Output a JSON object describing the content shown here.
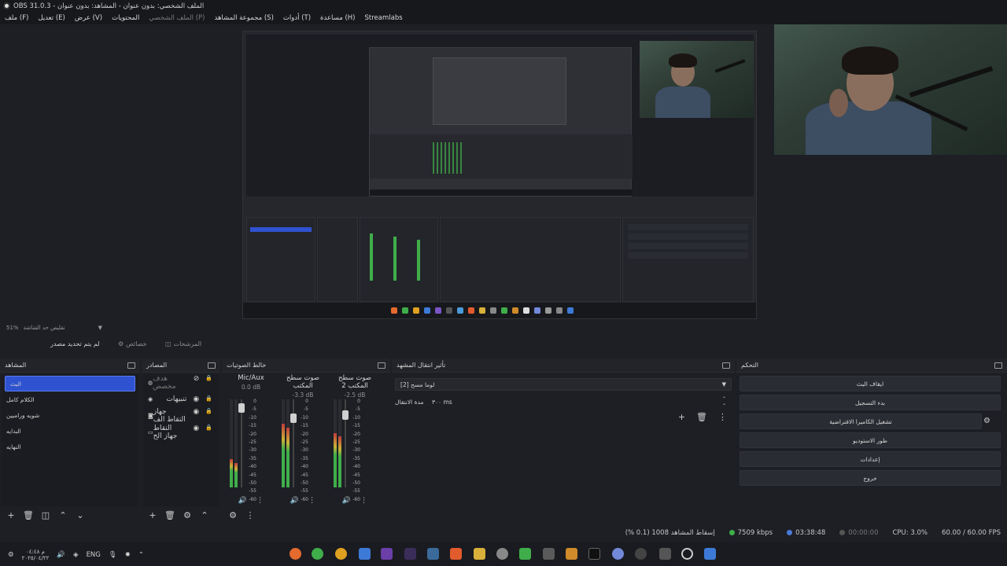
{
  "window": {
    "title": "OBS 31.0.3 - الملف الشخصي: بدون عنوان - المشاهد: بدون عنوان"
  },
  "menu": {
    "items": [
      {
        "label": "ملف (F)",
        "dim": false
      },
      {
        "label": "تعديل (E)",
        "dim": false
      },
      {
        "label": "عرض (V)",
        "dim": false
      },
      {
        "label": "المحتويات",
        "dim": false
      },
      {
        "label": "الملف الشخصي (P)",
        "dim": true
      },
      {
        "label": "مجموعة المشاهد (S)",
        "dim": false
      },
      {
        "label": "أدوات (T)",
        "dim": false
      },
      {
        "label": "مساعدة (H)",
        "dim": false
      },
      {
        "label": "Streamlabs",
        "dim": false
      }
    ]
  },
  "preview": {
    "zoom_label": "51%",
    "zoom_hint": "تقليص حد الشاشة"
  },
  "toolbar": {
    "no_source": "لم يتم تحديد مصدر",
    "properties": "خصائص",
    "filters": "المرشحات"
  },
  "scenes": {
    "title": "المشاهد",
    "items": [
      {
        "label": "البث",
        "active": true
      },
      {
        "label": "الكلام كامل",
        "active": false
      },
      {
        "label": "شويه ورامبين",
        "active": false
      },
      {
        "label": "البدايه",
        "active": false
      },
      {
        "label": "النهايه",
        "active": false
      }
    ]
  },
  "sources": {
    "title": "المصادر",
    "items": [
      {
        "label": "هدف مخصص",
        "dim": true
      },
      {
        "label": "تنبيهات",
        "dim": false
      },
      {
        "label": "جهاز التقاط الف",
        "dim": false
      },
      {
        "label": "التقاط جهاز الح",
        "dim": false
      }
    ]
  },
  "mixer": {
    "title": "خالط الصوتيات",
    "channels": [
      {
        "name": "Mic/Aux",
        "db": "0.0 dB",
        "level": 0.32,
        "fader": 0.95
      },
      {
        "name": "صوت سطح المكتب",
        "db": "-3.3 dB",
        "level": 0.72,
        "fader": 0.82
      },
      {
        "name": "صوت سطح المكتب 2",
        "db": "-2.5 dB",
        "level": 0.62,
        "fader": 0.86
      }
    ],
    "scale": [
      "0",
      "-5",
      "-10",
      "-15",
      "-20",
      "-25",
      "-30",
      "-35",
      "-40",
      "-45",
      "-50",
      "-55",
      "-60"
    ]
  },
  "transitions": {
    "title": "تأثير انتقال المشهد",
    "selected": "لوما مسح [2]",
    "duration_label": "مدة الانتقال",
    "duration_value": "٣٠٠ ms"
  },
  "controls": {
    "title": "التحكم",
    "buttons": [
      "ايقاف البث",
      "بدء التسجيل",
      "تشغيل الكاميرا الافتراضية",
      "طور الاستوديو",
      "إعدادات",
      "خروج"
    ]
  },
  "status": {
    "dropped": "إسقاط المشاهد 1008 (0.1 %)",
    "bitrate": "7509 kbps",
    "stream_time": "03:38:48",
    "rec_time": "00:00:00",
    "cpu": "CPU: 3.0%",
    "fps": "60.00 / 60.00 FPS"
  },
  "taskbar": {
    "lang": "ENG",
    "time": "م ٠٤:٤٨",
    "date": "٢٠٢٥/٠٤/٢٢"
  },
  "colors": {
    "accent": "#2f52d0",
    "green": "#3fae4a",
    "background": "#1d1f25"
  }
}
